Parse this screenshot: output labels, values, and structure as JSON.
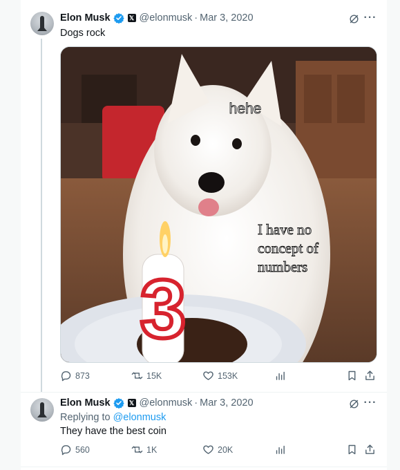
{
  "colors": {
    "accent": "#1d9bf0",
    "text": "#0f1419",
    "muted": "#536471"
  },
  "tweets": [
    {
      "author": "Elon Musk",
      "handle": "@elonmusk",
      "separator": "·",
      "date": "Mar 3, 2020",
      "text": "Dogs rock",
      "meme_captions": {
        "top": "hehe",
        "bottom": [
          "I have no",
          "concept of",
          "numbers"
        ]
      },
      "actions": {
        "replies": "873",
        "reposts": "15K",
        "likes": "153K"
      }
    },
    {
      "author": "Elon Musk",
      "handle": "@elonmusk",
      "separator": "·",
      "date": "Mar 3, 2020",
      "replying_prefix": "Replying to ",
      "replying_to": "@elonmusk",
      "text": "They have the best coin",
      "actions": {
        "replies": "560",
        "reposts": "1K",
        "likes": "20K"
      }
    }
  ],
  "icons": [
    "verified-badge-icon",
    "x-affiliate-badge-icon",
    "grok-icon",
    "more-icon",
    "reply-icon",
    "repost-icon",
    "like-icon",
    "views-icon",
    "bookmark-icon",
    "share-icon"
  ]
}
